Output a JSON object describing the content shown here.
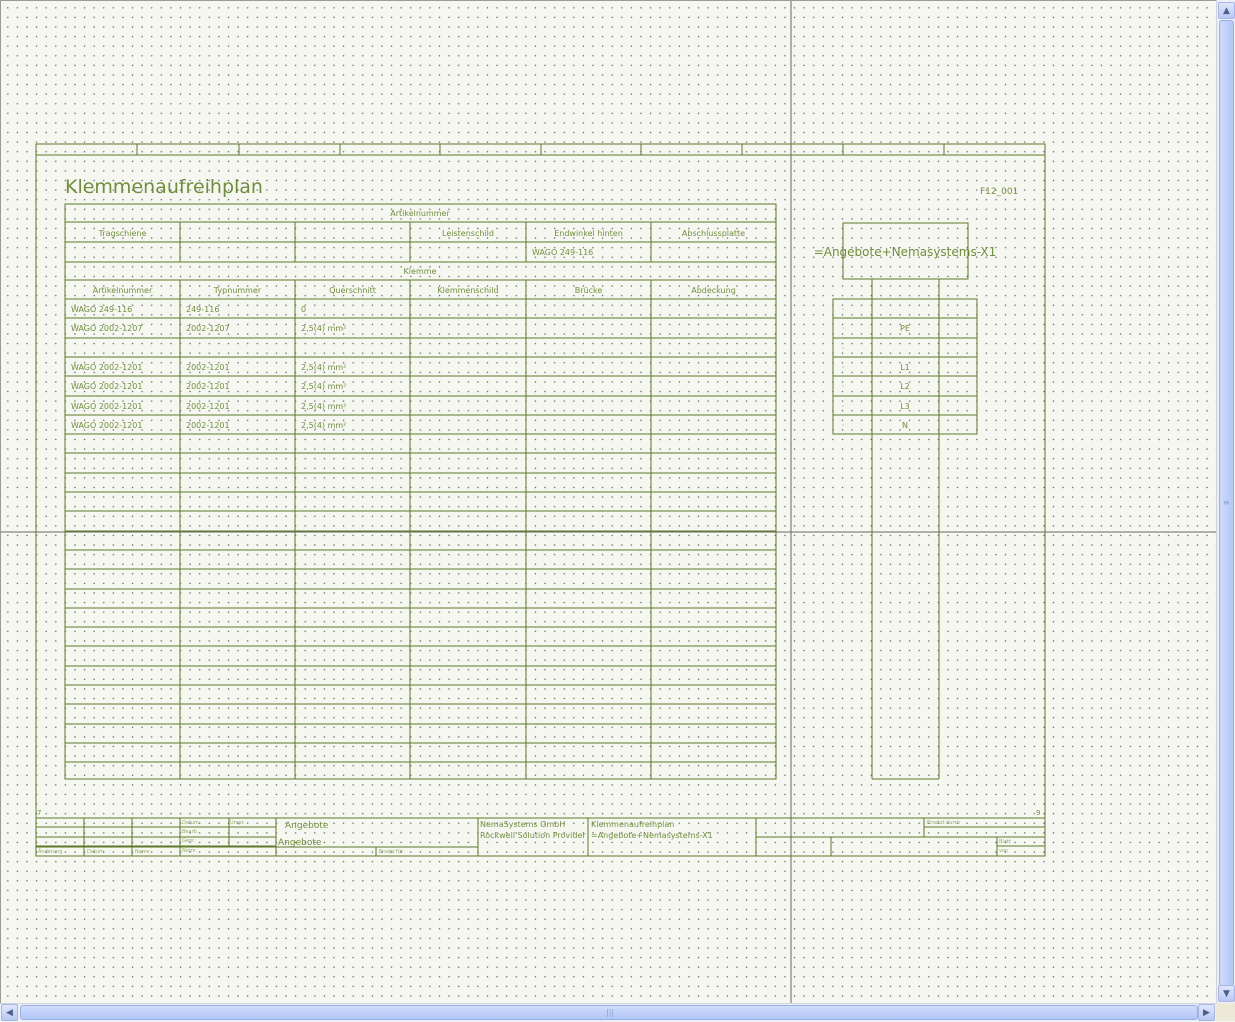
{
  "drawing": {
    "title": "Klemmenaufreihplan",
    "sheet_ref": "F12_001",
    "section_articles": "Artikelnummer",
    "section_terminal": "Klemme",
    "header_top": [
      "Tragschiene",
      "",
      "",
      "Leistenschild",
      "Endwinkel hinten",
      "Abschlussplatte"
    ],
    "header_top_values": [
      "",
      "",
      "",
      "",
      "WAGO 249-116",
      ""
    ],
    "columns": [
      "Artikelnummer",
      "Typnummer",
      "Querschnitt",
      "Klemmenschild",
      "Brücke",
      "Abdeckung"
    ],
    "rows": [
      [
        "WAGO 249-116",
        "249-116",
        "0",
        "",
        "",
        ""
      ],
      [
        "WAGO 2002-1207",
        "2002-1207",
        "2,5(4) mm²",
        "",
        "",
        ""
      ],
      [
        "",
        "",
        "",
        "",
        "",
        ""
      ],
      [
        "WAGO 2002-1201",
        "2002-1201",
        "2,5(4) mm²",
        "",
        "",
        ""
      ],
      [
        "WAGO 2002-1201",
        "2002-1201",
        "2,5(4) mm²",
        "",
        "",
        ""
      ],
      [
        "WAGO 2002-1201",
        "2002-1201",
        "2,5(4) mm²",
        "",
        "",
        ""
      ],
      [
        "WAGO 2002-1201",
        "2002-1201",
        "2,5(4) mm²",
        "",
        "",
        ""
      ]
    ],
    "strip_label": "=Angebote+Nemasystems-X1",
    "terminals": [
      "",
      "PE",
      "",
      "L1",
      "L2",
      "L3",
      "N"
    ],
    "corner_left": "7",
    "corner_right": "9"
  },
  "title_block": {
    "project1": "Angebote",
    "project2": "Angebote",
    "company1": "NemaSystems GmbH",
    "company2": "Rockwell Solution Provider",
    "plan_title": "Klemmenaufreihplan",
    "plan_ref": "=Angebote+Nemasystems-X1",
    "small_labels": [
      "Datum",
      "Bearb.",
      "Gepr.",
      "Norm",
      "Änderung",
      "Datum",
      "Name",
      "Urspr.",
      "Ersatz für",
      "Ersetzt durch",
      "Blatt",
      "von"
    ]
  },
  "colors": {
    "line": "#5b7a28",
    "text": "#6f8f3c",
    "dots": "#6c6c6c",
    "background": "#f7f7f2"
  }
}
